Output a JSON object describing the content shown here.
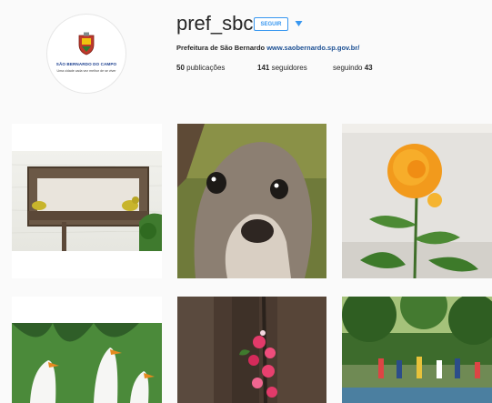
{
  "profile": {
    "username": "pref_sbc",
    "follow_label": "SEGUIR",
    "avatar_city": "SÃO BERNARDO DO CAMPO",
    "avatar_slogan": "Uma cidade cada vez melhor de se viver",
    "bio_name": "Prefeitura de São Bernardo",
    "bio_link": "www.saobernardo.sp.gov.br/",
    "stats": {
      "posts_count": "50",
      "posts_label": "publicações",
      "followers_count": "141",
      "followers_label": "seguidores",
      "following_label": "seguindo",
      "following_count": "43"
    }
  },
  "posts": [
    {
      "subject": "birds on wooden feeder"
    },
    {
      "subject": "animal close-up"
    },
    {
      "subject": "orange rose"
    },
    {
      "subject": "white geese"
    },
    {
      "subject": "pink flowers on wooden fence"
    },
    {
      "subject": "people in park"
    }
  ],
  "colors": {
    "accent": "#3897f0",
    "link": "#1b4f93",
    "background": "#fafafa"
  }
}
